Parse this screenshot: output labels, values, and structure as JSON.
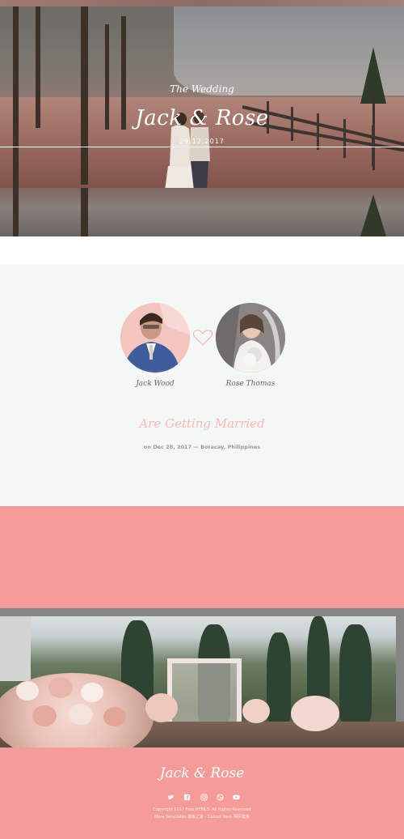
{
  "hero": {
    "subtitle": "The Wedding",
    "title": "Jack & Rose",
    "date": "29.12.2017"
  },
  "couple": {
    "groom_name": "Jack Wood",
    "bride_name": "Rose Thomas",
    "headline": "Are Getting Married",
    "detail": "on Dec 28, 2017 — Boracay, Philippines"
  },
  "footer": {
    "title": "Jack & Rose",
    "social_icons": [
      "twitter-icon",
      "facebook-icon",
      "instagram-icon",
      "dribbble-icon",
      "youtube-icon"
    ],
    "copyright": "Copyright 2017 Free HTML5. All Rights Reserved",
    "extra": "More Templates 模板之家 - Collect from 网页模板"
  },
  "colors": {
    "pink": "#f59c9a",
    "mint": "#f3f8f6",
    "accent_text": "#f7b9b7"
  }
}
